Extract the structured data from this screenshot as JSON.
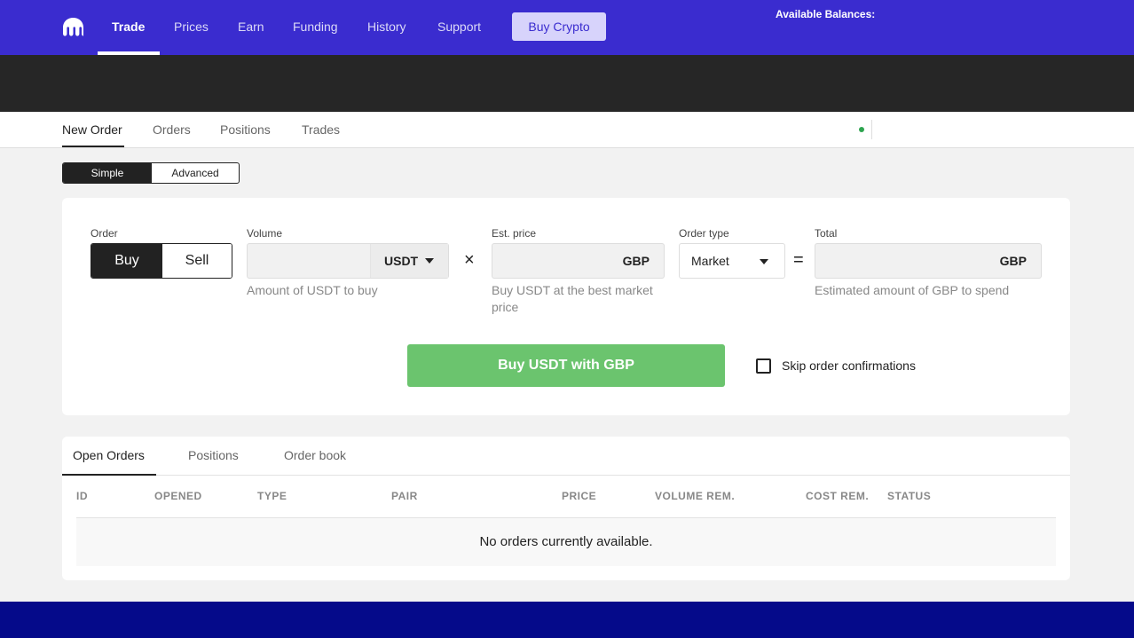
{
  "topnav": {
    "logo_icon": "kraken-logo-icon",
    "items": [
      {
        "label": "Trade",
        "active": true
      },
      {
        "label": "Prices",
        "active": false
      },
      {
        "label": "Earn",
        "active": false
      },
      {
        "label": "Funding",
        "active": false
      },
      {
        "label": "History",
        "active": false
      },
      {
        "label": "Support",
        "active": false
      }
    ],
    "buy_crypto_label": "Buy Crypto",
    "balances_label": "Available Balances:",
    "background_color": "#3a2ccf"
  },
  "subtabs": {
    "items": [
      {
        "label": "New Order",
        "active": true
      },
      {
        "label": "Orders",
        "active": false
      },
      {
        "label": "Positions",
        "active": false
      },
      {
        "label": "Trades",
        "active": false
      }
    ],
    "status_color": "#2ea44f"
  },
  "mode_toggle": {
    "simple_label": "Simple",
    "advanced_label": "Advanced",
    "selected": "Simple"
  },
  "order_form": {
    "order_label": "Order",
    "buy_label": "Buy",
    "sell_label": "Sell",
    "side_selected": "Buy",
    "volume_label": "Volume",
    "volume_value": "",
    "volume_unit": "USDT",
    "volume_hint": "Amount of USDT to buy",
    "multiply_symbol": "×",
    "est_price_label": "Est. price",
    "est_price_value": "",
    "est_price_unit": "GBP",
    "est_price_hint": "Buy USDT at the best market price",
    "order_type_label": "Order type",
    "order_type_value": "Market",
    "equals_symbol": "=",
    "total_label": "Total",
    "total_value": "",
    "total_unit": "GBP",
    "total_hint": "Estimated amount of GBP to spend",
    "submit_label": "Buy USDT with GBP",
    "submit_color": "#6bc46e",
    "skip_confirm_label": "Skip order confirmations",
    "skip_confirm_checked": false
  },
  "orders_panel": {
    "tabs": [
      {
        "label": "Open Orders",
        "active": true
      },
      {
        "label": "Positions",
        "active": false
      },
      {
        "label": "Order book",
        "active": false
      }
    ],
    "columns": [
      "ID",
      "OPENED",
      "TYPE",
      "PAIR",
      "PRICE",
      "VOLUME REM.",
      "COST REM.",
      "STATUS"
    ],
    "empty_message": "No orders currently available."
  }
}
